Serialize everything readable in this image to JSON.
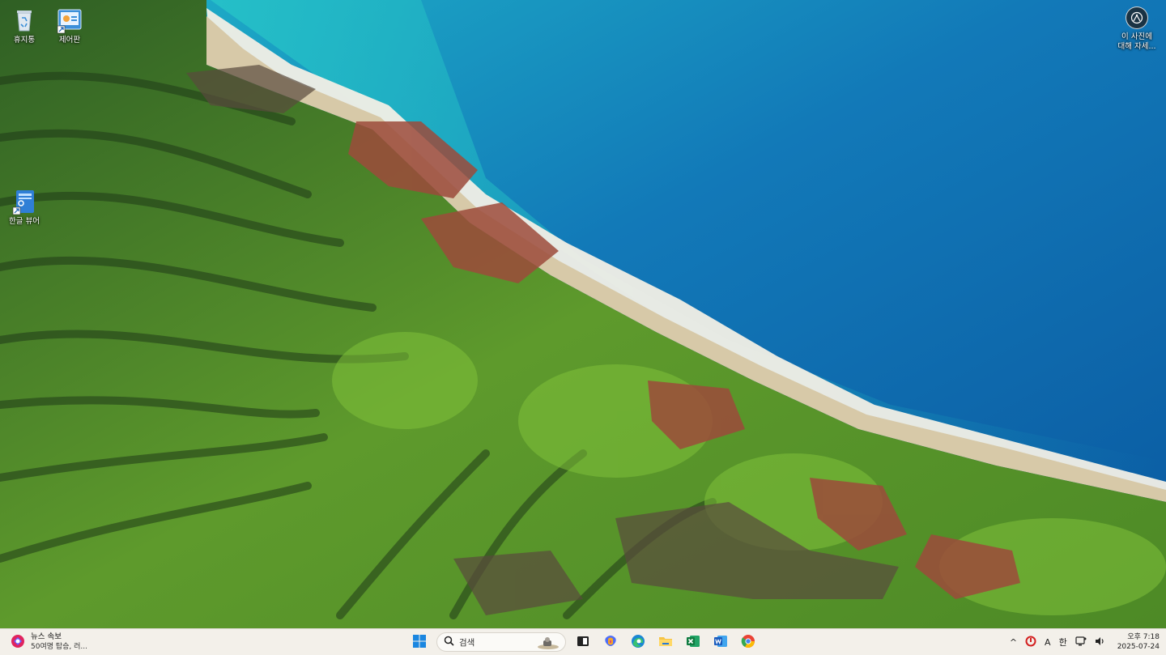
{
  "desktop": {
    "icons": [
      {
        "label": "휴지통",
        "icon": "recycle-bin-icon"
      },
      {
        "label": "제어판",
        "icon": "control-panel-icon"
      },
      {
        "label": "한글 뷰어",
        "icon": "hangul-viewer-icon"
      }
    ],
    "photo_info": {
      "line1": "이 사진에",
      "line2": "대해 자세...",
      "icon": "camera-icon"
    }
  },
  "taskbar": {
    "news": {
      "title": "뉴스 속보",
      "subtitle": "50여명 탑승, 러...",
      "icon": "news-icon"
    },
    "start_icon": "windows-start-icon",
    "search": {
      "placeholder": "검색",
      "icon": "search-icon"
    },
    "pinned": [
      {
        "name": "task-view",
        "icon": "task-view-icon"
      },
      {
        "name": "copilot",
        "icon": "copilot-icon"
      },
      {
        "name": "edge",
        "icon": "edge-icon"
      },
      {
        "name": "file-explorer",
        "icon": "folder-icon"
      },
      {
        "name": "excel",
        "icon": "excel-icon"
      },
      {
        "name": "word",
        "icon": "word-icon"
      },
      {
        "name": "chrome",
        "icon": "chrome-icon"
      }
    ],
    "tray": {
      "chevron": "^",
      "font_indicator": "A",
      "ime": "한",
      "time": "오후 7:18",
      "date": "2025-07-24"
    }
  },
  "colors": {
    "ocean_deep": "#0a5fa6",
    "ocean_shallow": "#1fb3c4",
    "land_green": "#4e8d2a",
    "taskbar_bg": "#f3f0ea"
  }
}
